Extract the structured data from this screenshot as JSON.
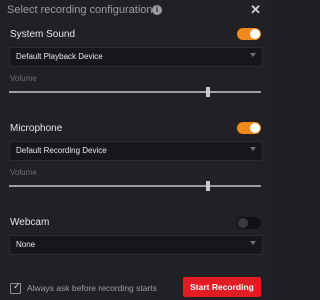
{
  "dialog": {
    "title": "Select recording configuration",
    "info_icon": "i",
    "close_icon": "✕"
  },
  "system_sound": {
    "label": "System Sound",
    "enabled": true,
    "device": "Default Playback Device",
    "volume_label": "Volume",
    "volume_fraction": 0.79
  },
  "microphone": {
    "label": "Microphone",
    "enabled": true,
    "device": "Default Recording Device",
    "volume_label": "Volume",
    "volume_fraction": 0.79
  },
  "webcam": {
    "label": "Webcam",
    "enabled": false,
    "device": "None"
  },
  "footer": {
    "checkbox_checked": true,
    "checkbox_label": "Always ask before recording starts",
    "start_button": "Start Recording"
  },
  "colors": {
    "accent": "#f08a1d",
    "start_button": "#e31b23",
    "background": "#202025"
  }
}
